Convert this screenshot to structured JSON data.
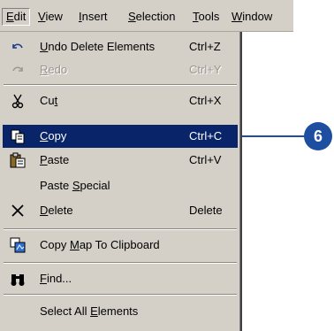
{
  "menubar": {
    "items": [
      {
        "label": "Edit"
      },
      {
        "label": "View"
      },
      {
        "label": "Insert"
      },
      {
        "label": "Selection"
      },
      {
        "label": "Tools"
      },
      {
        "label": "Window"
      }
    ]
  },
  "menu": {
    "items": [
      {
        "label": "Undo Delete Elements",
        "shortcut": "Ctrl+Z",
        "icon": "undo-icon"
      },
      {
        "label": "Redo",
        "shortcut": "Ctrl+Y",
        "icon": "redo-icon",
        "disabled": true
      },
      {
        "label": "Cut",
        "shortcut": "Ctrl+X",
        "icon": "scissors-icon"
      },
      {
        "label": "Copy",
        "shortcut": "Ctrl+C",
        "icon": "copy-icon",
        "highlighted": true
      },
      {
        "label": "Paste",
        "shortcut": "Ctrl+V",
        "icon": "paste-icon"
      },
      {
        "label": "Paste Special",
        "shortcut": ""
      },
      {
        "label": "Delete",
        "shortcut": "Delete",
        "icon": "delete-x-icon"
      },
      {
        "label": "Copy Map To Clipboard",
        "shortcut": "",
        "icon": "copy-map-icon"
      },
      {
        "label": "Find...",
        "shortcut": "",
        "icon": "binoculars-icon"
      },
      {
        "label": "Select All Elements",
        "shortcut": ""
      }
    ]
  },
  "callout": {
    "number": "6"
  },
  "colors": {
    "highlight": "#0a246a",
    "callout": "#1d4ea0",
    "menu_bg": "#d4d0c8"
  }
}
